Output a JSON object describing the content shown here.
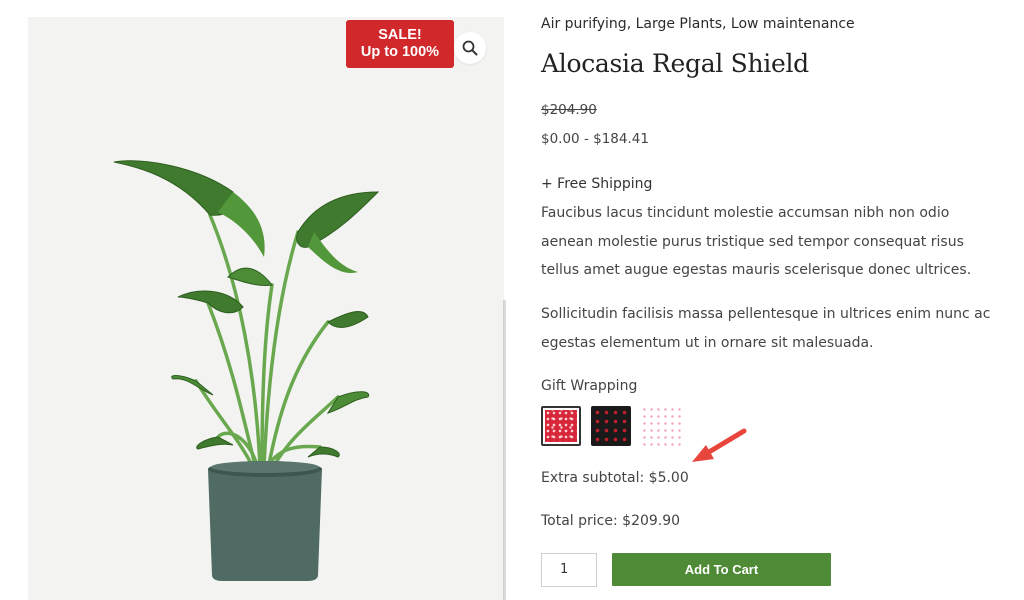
{
  "gallery": {
    "sale_badge": {
      "line1": "SALE!",
      "line2": "Up to 100%"
    },
    "zoom_icon": "magnifier-icon",
    "image": "potted-plant"
  },
  "product": {
    "categories": "Air purifying, Large Plants, Low maintenance",
    "title": "Alocasia Regal Shield",
    "old_price": "$204.90",
    "price_range": "$0.00 - $184.41",
    "shipping": "+ Free Shipping",
    "description": [
      "Faucibus lacus tincidunt molestie accumsan nibh non odio aenean molestie purus tristique sed tempor consequat risus tellus amet augue egestas mauris scelerisque donec ultrices.",
      "Sollicitudin facilisis massa pellentesque in ultrices enim nunc ac egestas elementum ut in ornare sit malesuada."
    ]
  },
  "gift_wrapping": {
    "label": "Gift Wrapping",
    "options": [
      {
        "pattern": "red-with-white-dots",
        "selected": true
      },
      {
        "pattern": "black-with-red-dots",
        "selected": false
      },
      {
        "pattern": "white-with-pink-dots",
        "selected": false
      }
    ]
  },
  "totals": {
    "extra_subtotal_label": "Extra subtotal:",
    "extra_subtotal_value": "$5.00",
    "total_label": "Total price:",
    "total_value": "$209.90"
  },
  "cart": {
    "quantity": "1",
    "add_button": "Add To Cart"
  },
  "colors": {
    "sale": "#d0282b",
    "add_to_cart": "#4f8b36",
    "annotation_arrow": "#e8453c"
  }
}
